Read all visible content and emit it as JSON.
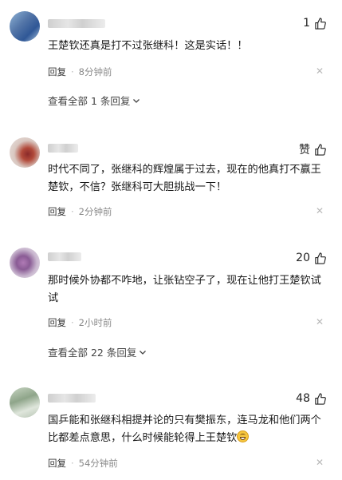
{
  "comments": [
    {
      "like_label": "1",
      "text": "王楚钦还真是打不过张继科！这是实话！！",
      "reply_label": "回复",
      "time": "8分钟前",
      "view_all": "查看全部 1 条回复"
    },
    {
      "like_label": "赞",
      "text": "时代不同了，张继科的辉煌属于过去，现在的他真打不赢王楚钦，不信？张继科可大胆挑战一下！",
      "reply_label": "回复",
      "time": "2分钟前"
    },
    {
      "like_label": "20",
      "text": "那时候外协都不咋地，让张钻空子了，现在让他打王楚钦试试",
      "reply_label": "回复",
      "time": "2小时前",
      "view_all": "查看全部 22 条回复"
    },
    {
      "like_label": "48",
      "text": "国乒能和张继科相提并论的只有樊振东，连马龙和他们两个比都差点意思，什么时候能轮得上王楚钦",
      "reply_label": "回复",
      "time": "54分钟前"
    }
  ],
  "icons": {
    "like": "thumbs-up-icon",
    "close": "close-icon",
    "expand": "chevron-down-icon",
    "emoji": "grin-emoji-icon"
  },
  "colors": {
    "meta": "#8a8a8a",
    "text": "#1a1a1a"
  }
}
